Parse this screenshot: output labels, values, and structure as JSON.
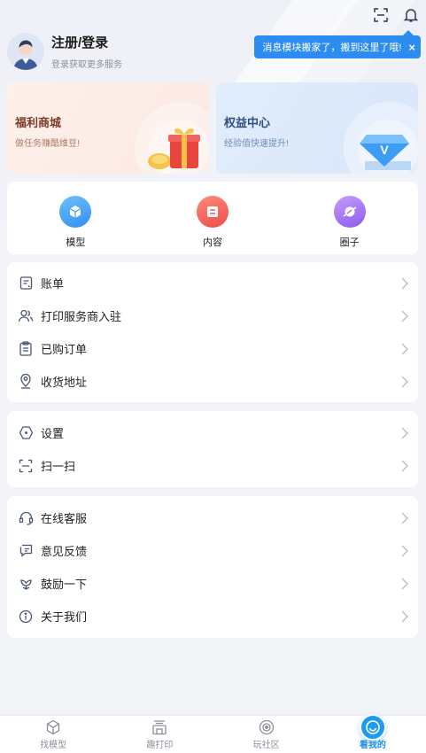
{
  "profile": {
    "title": "注册/登录",
    "subtitle": "登录获取更多服务"
  },
  "tooltip": {
    "text": "消息模块搬家了，搬到这里了哦!",
    "close": "×"
  },
  "cards": [
    {
      "title": "福利商城",
      "subtitle": "做任务赚酷维豆!"
    },
    {
      "title": "权益中心",
      "subtitle": "经验值快速提升!"
    }
  ],
  "quick": [
    {
      "label": "模型",
      "icon": "cube-icon",
      "color": "#3b9bf2"
    },
    {
      "label": "内容",
      "icon": "document-icon",
      "color": "#f25a53"
    },
    {
      "label": "圈子",
      "icon": "planet-icon",
      "color": "#9b6cf0"
    }
  ],
  "group1": [
    {
      "label": "账单",
      "icon": "bill-icon"
    },
    {
      "label": "打印服务商入驻",
      "icon": "people-icon"
    },
    {
      "label": "已购订单",
      "icon": "clipboard-icon"
    },
    {
      "label": "收货地址",
      "icon": "location-icon"
    }
  ],
  "group2": [
    {
      "label": "设置",
      "icon": "hexagon-settings-icon"
    },
    {
      "label": "扫一扫",
      "icon": "scan-icon"
    }
  ],
  "group3": [
    {
      "label": "在线客服",
      "icon": "headset-icon"
    },
    {
      "label": "意见反馈",
      "icon": "feedback-icon"
    },
    {
      "label": "鼓励一下",
      "icon": "flower-icon"
    },
    {
      "label": "关于我们",
      "icon": "info-icon"
    }
  ],
  "tabs": [
    {
      "label": "找模型",
      "icon": "cube-outline-icon",
      "active": false
    },
    {
      "label": "趣打印",
      "icon": "printer-icon",
      "active": false
    },
    {
      "label": "玩社区",
      "icon": "target-icon",
      "active": false
    },
    {
      "label": "看我的",
      "icon": "smile-icon",
      "active": true
    }
  ],
  "colors": {
    "accent": "#1e9bf0",
    "tooltip_bg": "#2d8cf0",
    "background": "#f3f4f8"
  }
}
